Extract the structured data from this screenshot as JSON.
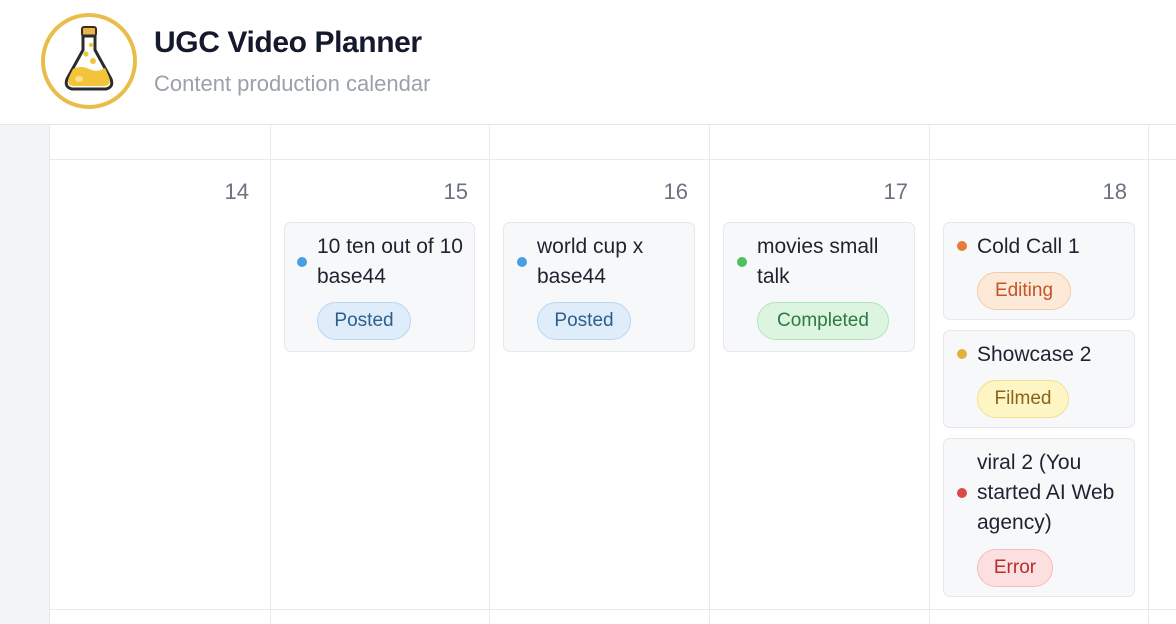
{
  "header": {
    "title": "UGC Video Planner",
    "subtitle": "Content production calendar",
    "logo_icon": "flask-icon"
  },
  "colors": {
    "posted": "#4a9fe0",
    "completed": "#4fbf62",
    "editing": "#e87a3c",
    "filmed": "#e0b43c",
    "error": "#db4a4a"
  },
  "calendar": {
    "days": [
      {
        "number": "14"
      },
      {
        "number": "15"
      },
      {
        "number": "16"
      },
      {
        "number": "17"
      },
      {
        "number": "18"
      }
    ],
    "events": {
      "d15": {
        "title": "10 ten out of 10 base44",
        "status": "Posted"
      },
      "d16": {
        "title": "world cup x base44",
        "status": "Posted"
      },
      "d17": {
        "title": "movies small talk",
        "status": "Completed"
      },
      "d18a": {
        "title": "Cold Call 1",
        "status": "Editing"
      },
      "d18b": {
        "title": "Showcase 2",
        "status": "Filmed"
      },
      "d18c": {
        "title": "viral 2 (You started AI Web agency)",
        "status": "Error"
      }
    }
  }
}
